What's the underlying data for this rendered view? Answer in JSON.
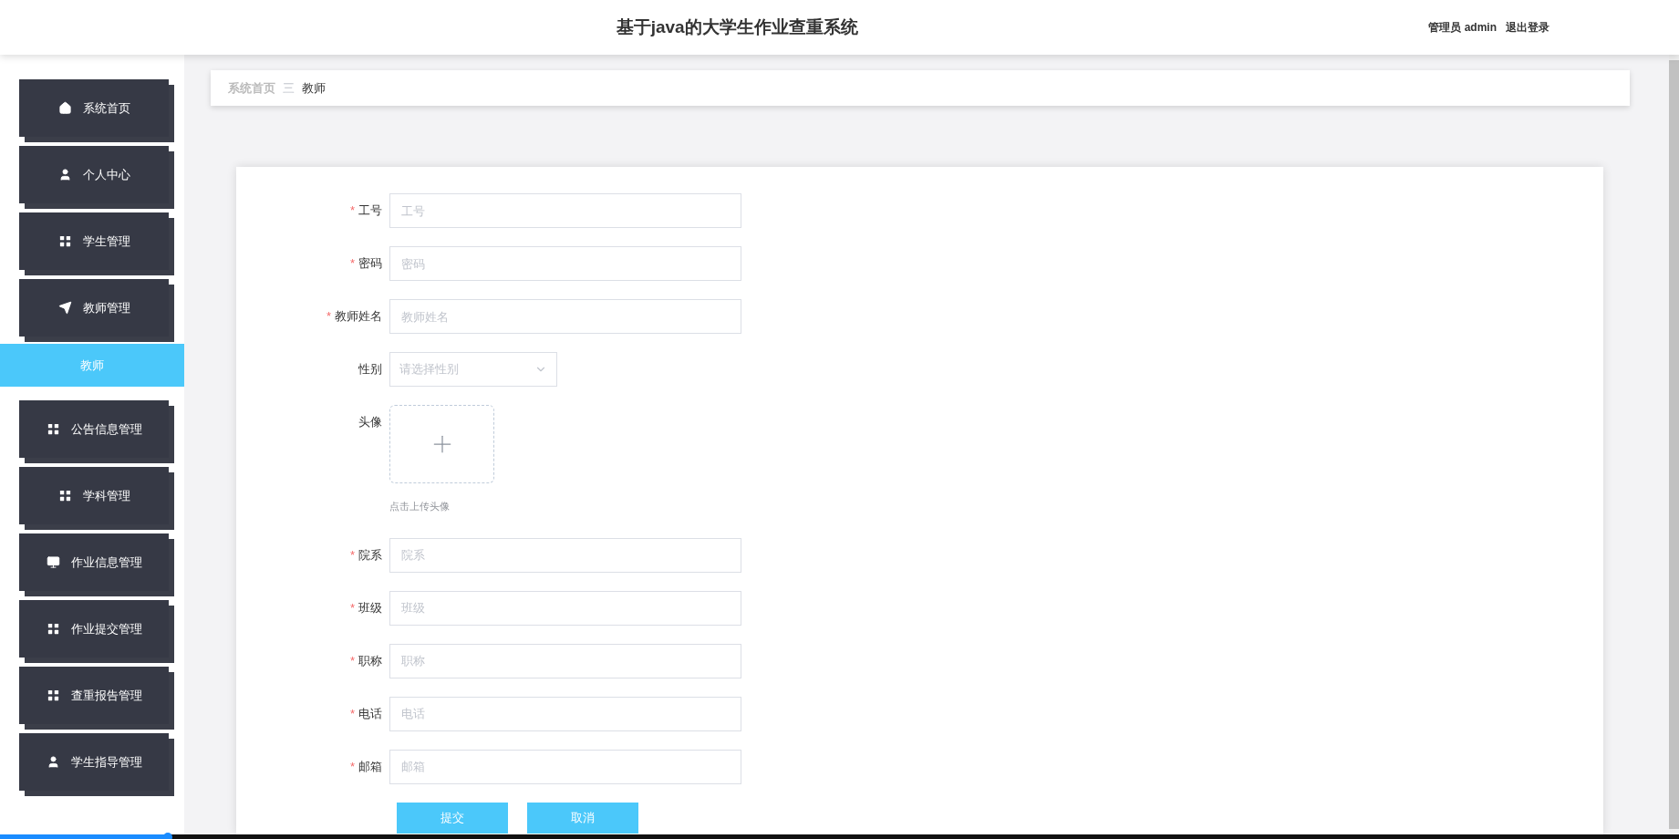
{
  "header": {
    "title": "基于java的大学生作业查重系统",
    "user": "管理员 admin",
    "logout": "退出登录"
  },
  "sidebar": {
    "items": [
      {
        "label": "系统首页",
        "selected": false
      },
      {
        "label": "个人中心",
        "selected": false
      },
      {
        "label": "学生管理",
        "selected": false
      },
      {
        "label": "教师管理",
        "selected": false,
        "children": [
          {
            "label": "教师",
            "selected": true
          }
        ]
      },
      {
        "label": "公告信息管理",
        "selected": false
      },
      {
        "label": "学科管理",
        "selected": false
      },
      {
        "label": "作业信息管理",
        "selected": false
      },
      {
        "label": "作业提交管理",
        "selected": false
      },
      {
        "label": "查重报告管理",
        "selected": false
      },
      {
        "label": "学生指导管理",
        "selected": false
      }
    ]
  },
  "breadcrumb": {
    "items": [
      "系统首页",
      "教师"
    ],
    "separator": "三"
  },
  "form": {
    "fields": [
      {
        "kind": "text",
        "label": "工号",
        "required_mark": "*",
        "placeholder": "工号"
      },
      {
        "kind": "text",
        "label": "密码",
        "required_mark": "*",
        "placeholder": "密码"
      },
      {
        "kind": "text",
        "label": "教师姓名",
        "required_mark": "*",
        "placeholder": "教师姓名"
      },
      {
        "kind": "select",
        "label": "性别",
        "placeholder": "请选择性别"
      },
      {
        "kind": "upload",
        "label": "头像",
        "hint": "点击上传头像"
      },
      {
        "kind": "text",
        "label": "院系",
        "required_mark": "*",
        "placeholder": "院系"
      },
      {
        "kind": "text",
        "label": "班级",
        "required_mark": "*",
        "placeholder": "班级"
      },
      {
        "kind": "text",
        "label": "职称",
        "required_mark": "*",
        "placeholder": "职称"
      },
      {
        "kind": "text",
        "label": "电话",
        "required_mark": "*",
        "placeholder": "电话"
      },
      {
        "kind": "text",
        "label": "邮箱",
        "required_mark": "*",
        "placeholder": "邮箱"
      }
    ],
    "buttons": [
      "提交",
      "取消"
    ]
  },
  "video_progress": {
    "level": 0.1
  }
}
